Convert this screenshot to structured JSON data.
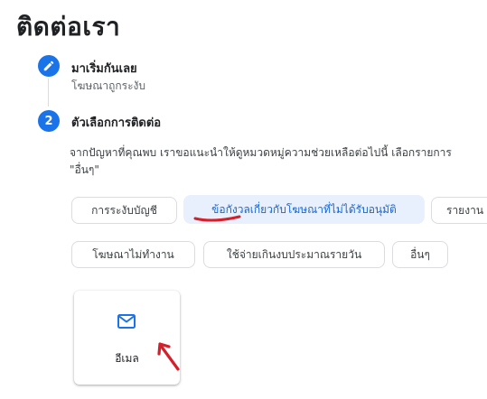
{
  "page": {
    "title": "ติดต่อเรา"
  },
  "steps": [
    {
      "number": "",
      "title": "มาเริ่มกันเลย",
      "subtitle": "โฆษณาถูกระงับ",
      "icon": "pencil-icon"
    },
    {
      "number": "2",
      "title": "ตัวเลือกการติดต่อ"
    }
  ],
  "description": {
    "line1": "จากปัญหาที่คุณพบ เราขอแนะนำให้ดูหมวดหมู่ความช่วยเหลือต่อไปนี้ เลือกรายการ",
    "line2": "\"อื่นๆ\""
  },
  "chips": [
    {
      "label": "การระงับบัญชี",
      "selected": false
    },
    {
      "label": "ข้อกังวลเกี่ยวกับโฆษณาที่ไม่ได้รับอนุมัติ",
      "selected": true
    },
    {
      "label": "รายงาน",
      "selected": false
    },
    {
      "label": "โฆษณาไม่ทำงาน",
      "selected": false
    },
    {
      "label": "ใช้จ่ายเกินงบประมาณรายวัน",
      "selected": false
    },
    {
      "label": "อื่นๆ",
      "selected": false
    }
  ],
  "contact_options": [
    {
      "label": "อีเมล",
      "icon": "mail-icon"
    }
  ],
  "colors": {
    "accent": "#1a73e8",
    "chip_selected_bg": "#e8f0fe",
    "chip_selected_text": "#1967d2",
    "annotation_red": "#d3202a"
  }
}
